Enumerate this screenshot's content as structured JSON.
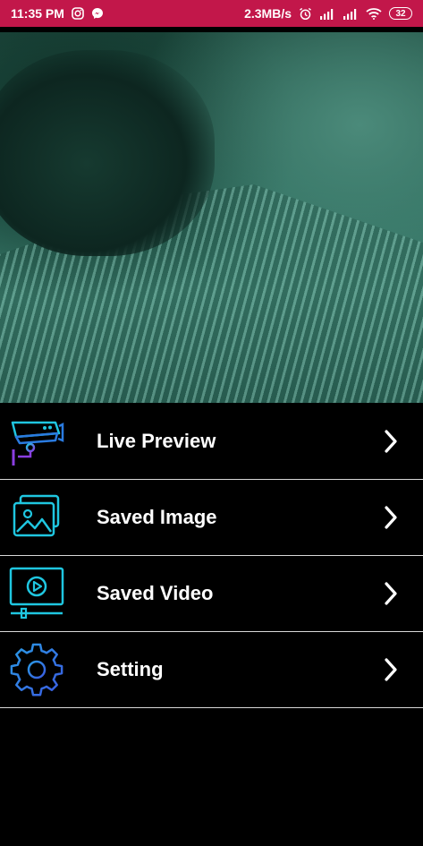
{
  "status_bar": {
    "time": "11:35 PM",
    "speed": "2.3MB/s",
    "battery": "32",
    "icons": [
      "instagram-icon",
      "messenger-icon",
      "alarm-icon",
      "signal-icon",
      "signal-icon",
      "wifi-icon",
      "battery-icon"
    ]
  },
  "preview": {
    "description_icon": "camera-preview"
  },
  "menu": {
    "items": [
      {
        "label": "Live Preview",
        "icon": "cctv-camera-icon"
      },
      {
        "label": "Saved Image",
        "icon": "image-gallery-icon"
      },
      {
        "label": "Saved Video",
        "icon": "video-player-icon"
      },
      {
        "label": "Setting",
        "icon": "gear-icon"
      }
    ]
  },
  "colors": {
    "status_bar": "#c2174a",
    "background": "#000000",
    "icon_cyan": "#1fc6e0",
    "icon_blue": "#2a7be0",
    "icon_purple": "#8a3ee0",
    "divider": "#d8d8d8"
  }
}
